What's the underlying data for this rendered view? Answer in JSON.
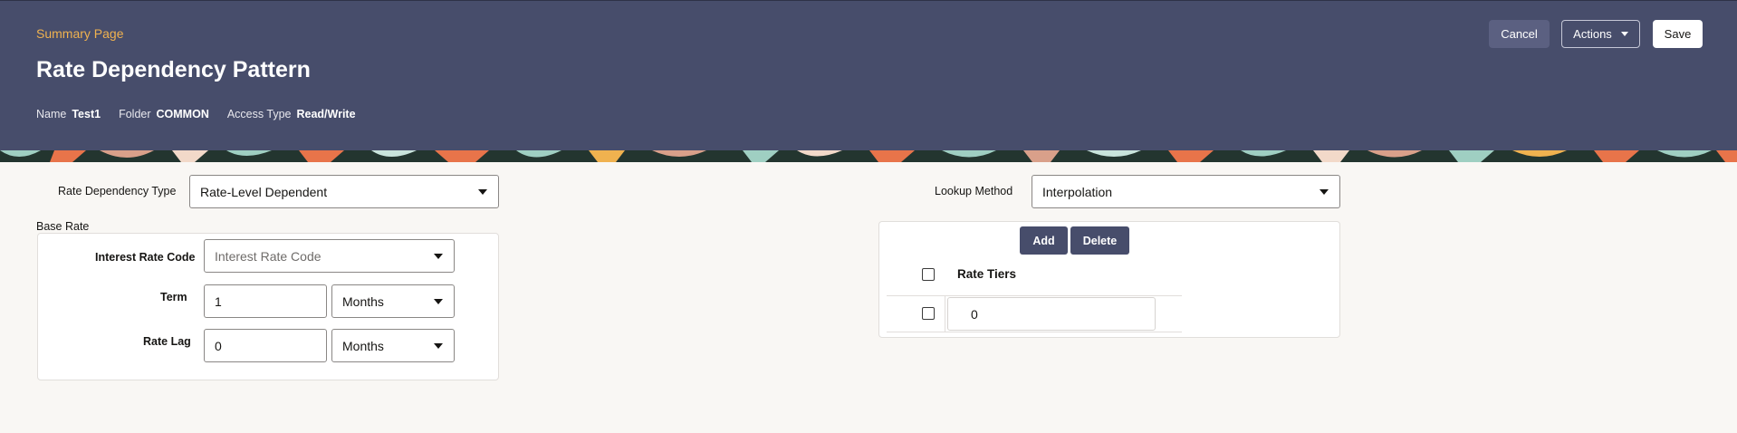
{
  "header": {
    "breadcrumb": "Summary Page",
    "title": "Rate Dependency Pattern",
    "meta": {
      "name_label": "Name",
      "name_value": "Test1",
      "folder_label": "Folder",
      "folder_value": "COMMON",
      "access_label": "Access Type",
      "access_value": "Read/Write"
    },
    "buttons": {
      "cancel": "Cancel",
      "actions": "Actions",
      "save": "Save"
    },
    "colors": {
      "background": "#474d6b",
      "breadcrumb": "#f0b24f"
    }
  },
  "form": {
    "rate_dependency_type_label": "Rate Dependency Type",
    "rate_dependency_type_value": "Rate-Level Dependent",
    "lookup_method_label": "Lookup Method",
    "lookup_method_value": "Interpolation",
    "base_rate": {
      "section_label": "Base Rate",
      "interest_rate_code_label": "Interest Rate Code",
      "interest_rate_code_placeholder": "Interest Rate Code",
      "term_label": "Term",
      "term_value": "1",
      "term_unit": "Months",
      "rate_lag_label": "Rate Lag",
      "rate_lag_value": "0",
      "rate_lag_unit": "Months"
    }
  },
  "rate_tiers": {
    "add_label": "Add",
    "delete_label": "Delete",
    "column_header": "Rate Tiers",
    "rows": [
      {
        "value": "0"
      }
    ]
  }
}
